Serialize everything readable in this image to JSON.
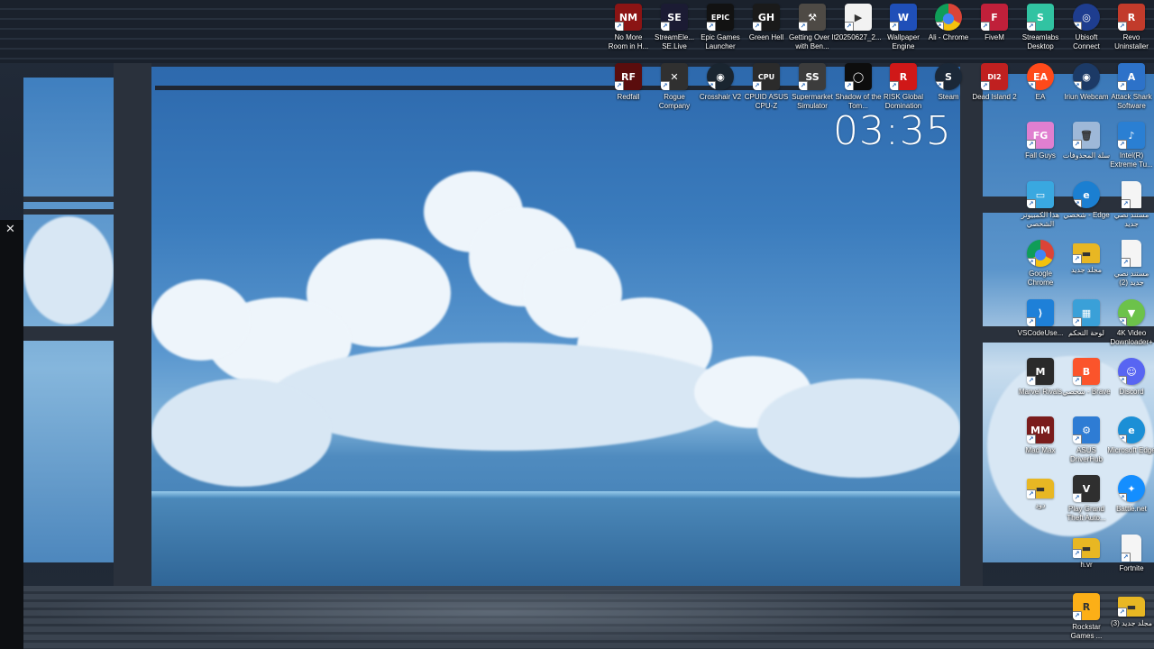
{
  "clock": {
    "time": "03:35"
  },
  "close_glyph": "✕",
  "icons": [
    {
      "label": "No More Room in H...",
      "glyph": "NM",
      "color": "#8b1414",
      "icon": "game-icon"
    },
    {
      "label": "StreamEle... SE.Live",
      "glyph": "SE",
      "color": "#1b1b33",
      "icon": "rocket-icon"
    },
    {
      "label": "Epic Games Launcher",
      "glyph": "EPIC",
      "color": "#121212",
      "icon": "epic-games-icon"
    },
    {
      "label": "Green Hell",
      "glyph": "GH",
      "color": "#1a1a1a",
      "icon": "game-icon"
    },
    {
      "label": "Getting Over It with Ben...",
      "glyph": "⚒",
      "color": "#4e4a45",
      "icon": "hammer-icon"
    },
    {
      "label": "20250627_2...",
      "glyph": "▶",
      "color": "#f2f2f2",
      "icon": "video-file-icon"
    },
    {
      "label": "Wallpaper Engine",
      "glyph": "W",
      "color": "#1f4fb8",
      "icon": "wallpaper-engine-icon"
    },
    {
      "label": "Ali - Chrome",
      "glyph": "●",
      "color": "#e8e8e8",
      "icon": "chrome-icon"
    },
    {
      "label": "FiveM",
      "glyph": "F",
      "color": "#c0203a",
      "icon": "fivem-icon"
    },
    {
      "label": "Streamlabs Desktop",
      "glyph": "S",
      "color": "#31c3a2",
      "icon": "streamlabs-icon"
    },
    {
      "label": "Ubisoft Connect",
      "glyph": "◎",
      "color": "#1e3d8f",
      "icon": "ubisoft-icon"
    },
    {
      "label": "Revo Uninstaller",
      "glyph": "R",
      "color": "#c23b2b",
      "icon": "revo-uninstaller-icon"
    },
    {
      "label": "Redfall",
      "glyph": "RF",
      "color": "#5a0d0d",
      "icon": "game-icon"
    },
    {
      "label": "Rogue Company",
      "glyph": "✕",
      "color": "#303030",
      "icon": "game-icon"
    },
    {
      "label": "Crosshair V2",
      "glyph": "◉",
      "color": "#1a2530",
      "icon": "crosshair-icon"
    },
    {
      "label": "CPUID ASUS CPU-Z",
      "glyph": "CPU",
      "color": "#2b2b2b",
      "icon": "cpu-icon"
    },
    {
      "label": "Supermarket Simulator",
      "glyph": "SS",
      "color": "#3c3c3c",
      "icon": "game-icon"
    },
    {
      "label": "Shadow of the Tom...",
      "glyph": "◯",
      "color": "#0d0d0d",
      "icon": "game-icon"
    },
    {
      "label": "RISK Global Domination",
      "glyph": "R",
      "color": "#d01818",
      "icon": "game-icon"
    },
    {
      "label": "Steam",
      "glyph": "S",
      "color": "#1b2838",
      "icon": "steam-icon"
    },
    {
      "label": "Dead Island 2",
      "glyph": "DI2",
      "color": "#c02020",
      "icon": "game-icon"
    },
    {
      "label": "EA",
      "glyph": "EA",
      "color": "#ff4a1a",
      "icon": "ea-icon"
    },
    {
      "label": "Iriun Webcam",
      "glyph": "◉",
      "color": "#1c3a66",
      "icon": "webcam-icon"
    },
    {
      "label": "Attack Shark Software",
      "glyph": "A",
      "color": "#2d72c9",
      "icon": "app-icon"
    },
    {
      "label": "Fall Guys",
      "glyph": "FG",
      "color": "#e07fd0",
      "icon": "game-icon"
    },
    {
      "label": "سلة المحذوفات",
      "glyph": "🗑",
      "color": "#9eb8d8",
      "icon": "recycle-bin-icon"
    },
    {
      "label": "Intel(R) Extreme Tu...",
      "glyph": "♪",
      "color": "#2a7fd3",
      "icon": "intel-icon"
    },
    {
      "label": "هذا الكمبيوتر الشخصي",
      "glyph": "▭",
      "color": "#39a8e0",
      "icon": "computer-icon"
    },
    {
      "label": "شخصي - Edge",
      "glyph": "e",
      "color": "#1b7fd1",
      "icon": "edge-icon"
    },
    {
      "label": "مستند نصي جديد",
      "glyph": "",
      "color": "#f5f5f5",
      "icon": "text-document-icon"
    },
    {
      "label": "Google Chrome",
      "glyph": "●",
      "color": "#e8e8e8",
      "icon": "chrome-icon"
    },
    {
      "label": "مجلد جديد",
      "glyph": "▬",
      "color": "#e8b723",
      "icon": "folder-icon"
    },
    {
      "label": "مستند نصي جديد (2)",
      "glyph": "",
      "color": "#f5f5f5",
      "icon": "text-document-icon"
    },
    {
      "label": "VSCodeUse...",
      "glyph": "⟩",
      "color": "#1e80d8",
      "icon": "vscode-icon"
    },
    {
      "label": "لوحة التحكم",
      "glyph": "▦",
      "color": "#3aa0d8",
      "icon": "control-panel-icon"
    },
    {
      "label": "4K Video Downloader+",
      "glyph": "▼",
      "color": "#6cc24a",
      "icon": "download-icon"
    },
    {
      "label": "Marvel Rivals",
      "glyph": "M",
      "color": "#2a2a2a",
      "icon": "game-icon"
    },
    {
      "label": "شخصي - Brave",
      "glyph": "B",
      "color": "#fb542b",
      "icon": "brave-icon"
    },
    {
      "label": "Discord",
      "glyph": "☺",
      "color": "#5865f2",
      "icon": "discord-icon"
    },
    {
      "label": "Mad Max",
      "glyph": "MM",
      "color": "#7a1c1c",
      "icon": "game-icon"
    },
    {
      "label": "ASUS DriverHub",
      "glyph": "⚙",
      "color": "#2e7cd4",
      "icon": "gear-icon"
    },
    {
      "label": "Microsoft Edge",
      "glyph": "e",
      "color": "#1b8fd6",
      "icon": "edge-icon"
    },
    {
      "label": "دود",
      "glyph": "▬",
      "color": "#e8b723",
      "icon": "folder-icon"
    },
    {
      "label": "Play Grand Theft Auto...",
      "glyph": "V",
      "color": "#2f2f2f",
      "icon": "game-icon"
    },
    {
      "label": "Battle.net",
      "glyph": "✦",
      "color": "#148eff",
      "icon": "battlenet-icon"
    },
    {
      "label": "h.vr",
      "glyph": "▬",
      "color": "#e8b723",
      "icon": "folder-icon"
    },
    {
      "label": "Fortnite",
      "glyph": "",
      "color": "#f5f5f5",
      "icon": "file-icon"
    },
    {
      "label": "Rockstar Games ...",
      "glyph": "R",
      "color": "#fcaf17",
      "icon": "rockstar-icon"
    },
    {
      "label": "مجلد جديد (3)",
      "glyph": "▬",
      "color": "#e8b723",
      "icon": "folder-icon"
    }
  ]
}
